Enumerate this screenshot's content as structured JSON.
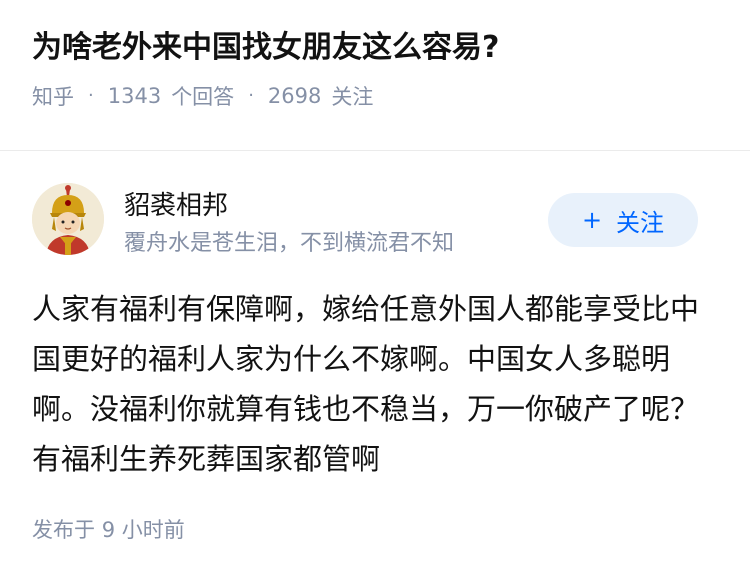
{
  "question": {
    "title": "为啥老外来中国找女朋友这么容易?",
    "source": "知乎",
    "separator": "·",
    "answer_count": "1343",
    "answer_label": "个回答",
    "follower_count": "2698",
    "follower_label": "关注"
  },
  "author": {
    "name": "貂裘相邦",
    "bio": "覆舟水是苍生泪，不到横流君不知",
    "follow_button": {
      "icon": "plus-icon",
      "icon_glyph": "+",
      "label": "关注"
    },
    "avatar_icon": "avatar-illustration-icon"
  },
  "answer": {
    "content": "人家有福利有保障啊，嫁给任意外国人都能享受比中国更好的福利人家为什么不嫁啊。中国女人多聪明啊。没福利你就算有钱也不稳当，万一你破产了呢？有福利生养死葬国家都管啊",
    "time_label": "发布于",
    "time_value": "9 小时前"
  },
  "colors": {
    "primary": "#0066ff",
    "button_bg": "#e8f1fb",
    "text_main": "#121212",
    "text_meta": "#8590a6",
    "divider": "#ebebeb"
  }
}
